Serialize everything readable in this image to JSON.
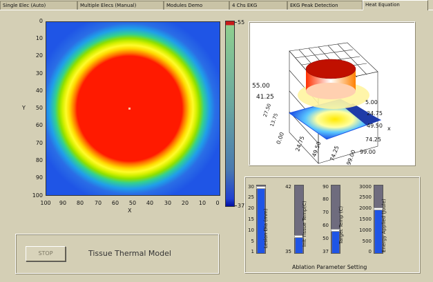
{
  "tabs": [
    {
      "label": "Single Elec (Auto)"
    },
    {
      "label": "Multiple Elecs (Manual)"
    },
    {
      "label": "Modules Demo"
    },
    {
      "label": "4 Chs EKG"
    },
    {
      "label": "EKG Peak Detection"
    },
    {
      "label": "Heat Equation"
    }
  ],
  "heatmap": {
    "ylabel": "Y",
    "xlabel": "X",
    "y_ticks": [
      "0",
      "10",
      "20",
      "30",
      "40",
      "50",
      "60",
      "70",
      "80",
      "90",
      "100"
    ],
    "x_ticks": [
      "100",
      "90",
      "80",
      "70",
      "60",
      "50",
      "40",
      "30",
      "20",
      "10",
      "0"
    ],
    "colorbar_max": "55",
    "colorbar_min": "37"
  },
  "surface": {
    "z_ticks": [
      "55.00",
      "41.25",
      "27.50",
      "13.75",
      "0.00"
    ],
    "x_ticks": [
      "5.00",
      "24.75",
      "49.50",
      "74.25",
      "99.00"
    ],
    "y_ticks": [
      "24.75",
      "49.50",
      "74.25",
      "99.00"
    ],
    "z_tick_left": [
      "55.00",
      "41.25"
    ],
    "yaxis_label": "x"
  },
  "controls": {
    "stop_label": "STOP",
    "title": "Tissue Thermal Model",
    "group_label": "Ablation Parameter Setting",
    "sliders": [
      {
        "label": "Lesion Dia (mm)",
        "ticks": [
          "30",
          "25",
          "20",
          "15",
          "10",
          "5",
          "1"
        ],
        "value": 29,
        "min": 1,
        "max": 30
      },
      {
        "label": "Init Tissue Temp(C)",
        "ticks": [
          "42",
          "35"
        ],
        "value": 36.7,
        "min": 35,
        "max": 42
      },
      {
        "label": "Target Temp (C)",
        "ticks": [
          "90",
          "80",
          "70",
          "60",
          "50",
          "37"
        ],
        "value": 55,
        "min": 37,
        "max": 90
      },
      {
        "label": "Energy Applied (Joule)",
        "ticks": [
          "3000",
          "2500",
          "2000",
          "1500",
          "1000",
          "500",
          "0"
        ],
        "value": 1950,
        "min": 0,
        "max": 3000
      }
    ]
  },
  "colors": {
    "hot": "#ff1a00",
    "cold": "#1f55e6",
    "track": "#6f6c7e"
  }
}
